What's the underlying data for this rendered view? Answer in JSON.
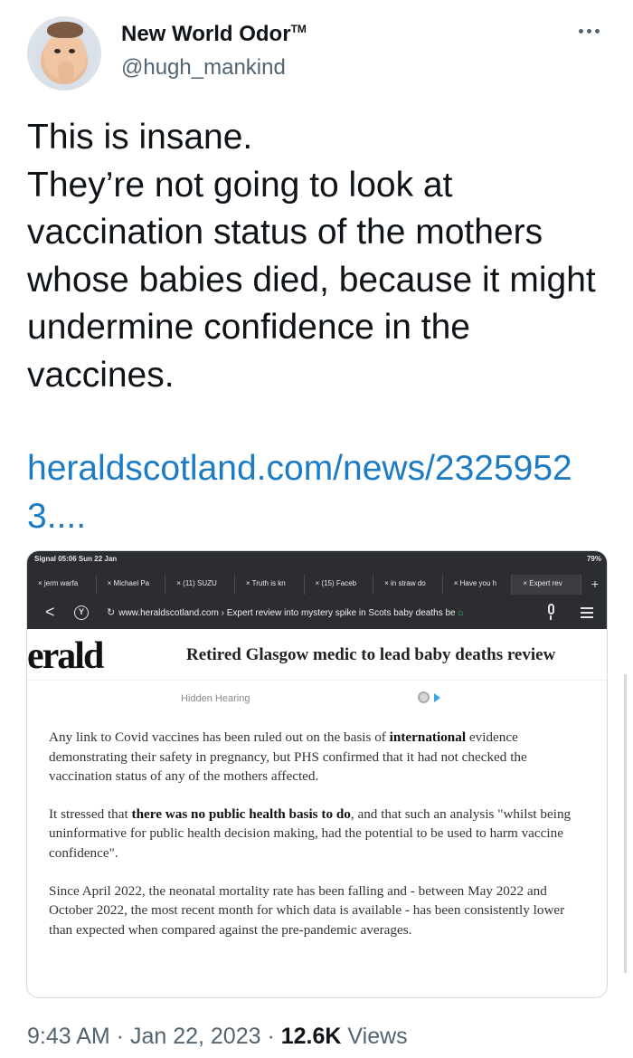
{
  "author": {
    "display_name": "New World Odor",
    "trademark": "TM",
    "handle": "@hugh_mankind"
  },
  "tweet": {
    "text": "This is insane.\nThey’re not going to look at vaccination status of the mothers whose babies died, because it might undermine confidence in the vaccines.",
    "link": "heraldscotland.com/news/23259523...."
  },
  "embedded_screenshot": {
    "status_left": "Signal  05:06  Sun 22 Jan",
    "status_right": "79%",
    "tabs": [
      "jerm warfa",
      "Michael Pa",
      "(11) SUZU",
      "Truth is kn",
      "(15) Faceb",
      "in straw do",
      "Have you h",
      "Expert rev"
    ],
    "tab_add": "+",
    "back_icon": "<",
    "y_button": "Y",
    "url": "www.heraldscotland.com › Expert review into mystery spike in Scots baby deaths be",
    "logo": "erald",
    "headline": "Retired Glasgow medic to lead baby deaths review",
    "ad_label": "Hidden Hearing",
    "paragraph1_a": "Any link to Covid vaccines has been ruled out on the basis of ",
    "paragraph1_bold": "international",
    "paragraph1_b": " evidence demonstrating their safety in pregnancy, but PHS confirmed that it had not checked the vaccination status of any of the mothers affected.",
    "paragraph2_a": "It stressed that ",
    "paragraph2_bold": "there was no public health basis to do",
    "paragraph2_b": ", and that such an analysis \"whilst being uninformative for public health decision making, had the potential to be used to harm vaccine confidence\".",
    "paragraph3": "Since April 2022, the neonatal mortality rate has been falling and - between May 2022 and October 2022, the most recent month for which data is available - has been consistently lower than expected when compared against the pre-pandemic averages."
  },
  "meta": {
    "time": "9:43 AM",
    "date": "Jan 22, 2023",
    "separator": " · ",
    "views_count": "12.6K",
    "views_label": "Views"
  }
}
